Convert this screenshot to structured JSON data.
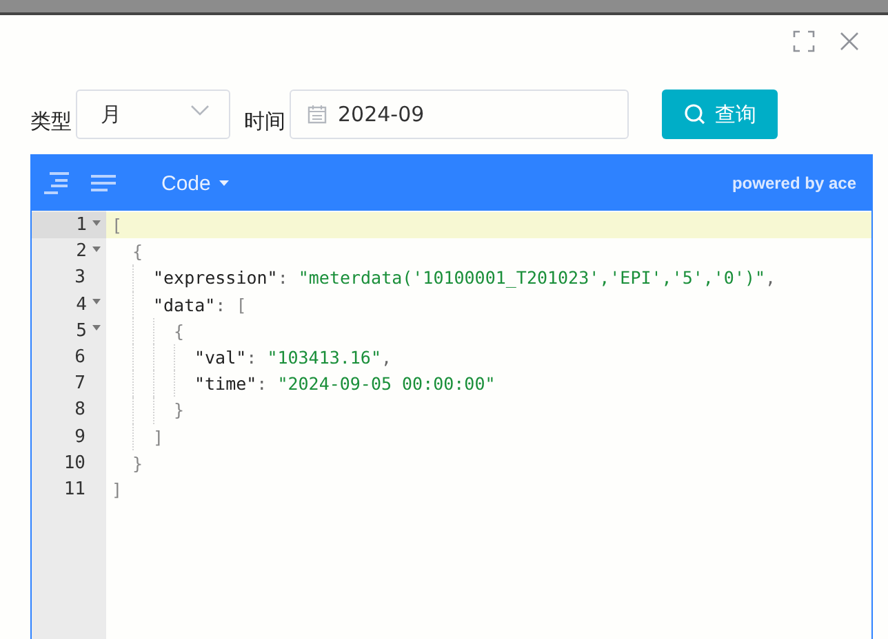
{
  "dialog": {
    "form": {
      "type_label": "类型",
      "type_select": {
        "value": "月"
      },
      "time_label": "时间",
      "time_field": {
        "value": "2024-09"
      },
      "query_button": "查询"
    }
  },
  "editor": {
    "toolbar": {
      "mode_menu": "Code",
      "branding": "powered by ace"
    },
    "lines": [
      {
        "number": "1",
        "foldable": true,
        "active": true,
        "tokens": [
          {
            "kind": "open",
            "text": "["
          }
        ]
      },
      {
        "number": "2",
        "foldable": true,
        "active": false,
        "tokens": [
          {
            "kind": "open",
            "text": "{"
          }
        ]
      },
      {
        "number": "3",
        "foldable": false,
        "active": false,
        "tokens": [
          {
            "kind": "key",
            "text": "\"expression\""
          },
          {
            "kind": "punct",
            "text": ": "
          },
          {
            "kind": "string",
            "text": "\"meterdata('10100001_T201023','EPI','5','0')\""
          },
          {
            "kind": "punct",
            "text": ","
          }
        ]
      },
      {
        "number": "4",
        "foldable": true,
        "active": false,
        "tokens": [
          {
            "kind": "key",
            "text": "\"data\""
          },
          {
            "kind": "punct",
            "text": ": "
          },
          {
            "kind": "open",
            "text": "["
          }
        ]
      },
      {
        "number": "5",
        "foldable": true,
        "active": false,
        "tokens": [
          {
            "kind": "open",
            "text": "{"
          }
        ]
      },
      {
        "number": "6",
        "foldable": false,
        "active": false,
        "tokens": [
          {
            "kind": "key",
            "text": "\"val\""
          },
          {
            "kind": "punct",
            "text": ": "
          },
          {
            "kind": "string",
            "text": "\"103413.16\""
          },
          {
            "kind": "punct",
            "text": ","
          }
        ]
      },
      {
        "number": "7",
        "foldable": false,
        "active": false,
        "tokens": [
          {
            "kind": "key",
            "text": "\"time\""
          },
          {
            "kind": "punct",
            "text": ": "
          },
          {
            "kind": "string",
            "text": "\"2024-09-05 00:00:00\""
          }
        ]
      },
      {
        "number": "8",
        "foldable": false,
        "active": false,
        "tokens": [
          {
            "kind": "close",
            "text": "}"
          }
        ]
      },
      {
        "number": "9",
        "foldable": false,
        "active": false,
        "tokens": [
          {
            "kind": "close",
            "text": "]"
          }
        ]
      },
      {
        "number": "10",
        "foldable": false,
        "active": false,
        "tokens": [
          {
            "kind": "close",
            "text": "}"
          }
        ]
      },
      {
        "number": "11",
        "foldable": false,
        "active": false,
        "tokens": [
          {
            "kind": "close",
            "text": "]"
          }
        ]
      }
    ]
  }
}
